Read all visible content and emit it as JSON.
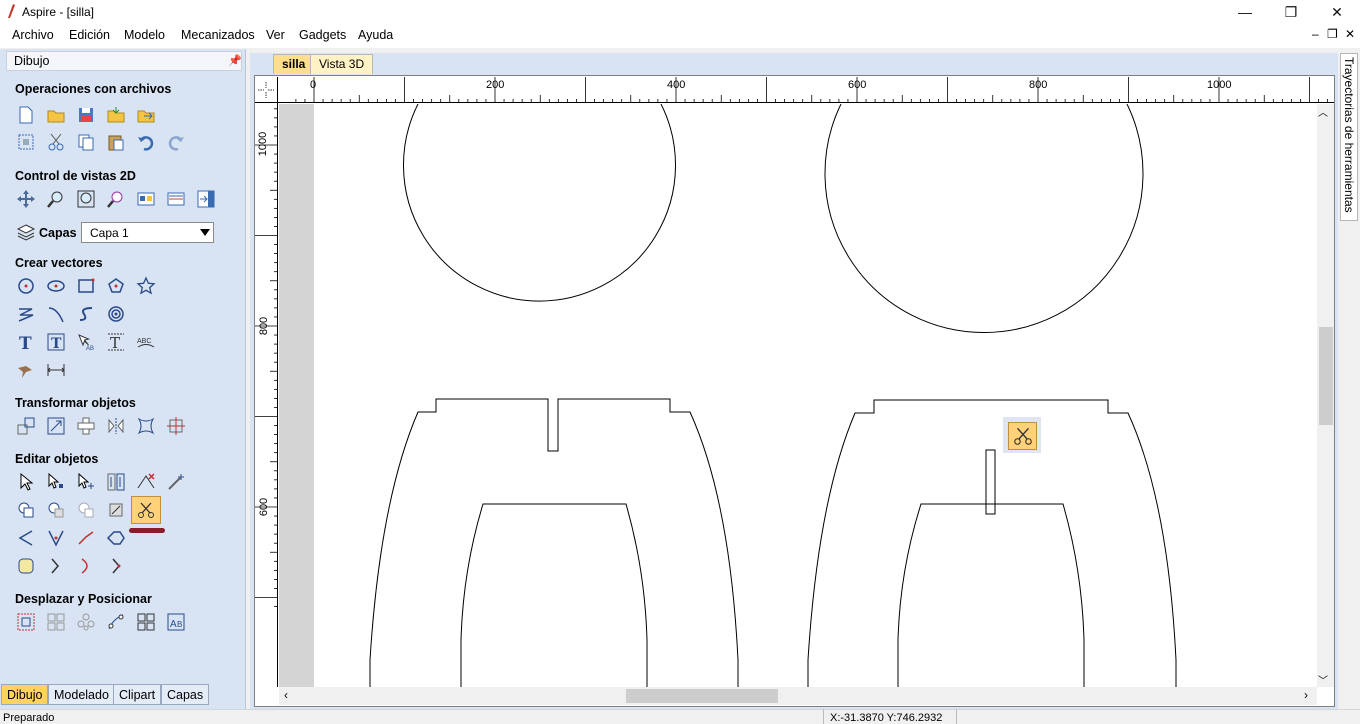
{
  "window": {
    "title": "Aspire - [silla]",
    "controls": [
      "—",
      "❐",
      "✕"
    ]
  },
  "menubar": {
    "items": [
      "Archivo",
      "Edición",
      "Modelo",
      "Mecanizados",
      "Ver",
      "Gadgets",
      "Ayuda"
    ],
    "mdi_controls": [
      "–",
      "❐",
      "✕"
    ]
  },
  "panel": {
    "title": "Dibujo",
    "sections": {
      "files": "Operaciones con archivos",
      "views": "Control de vistas 2D",
      "layers_label": "Capas",
      "create": "Crear vectores",
      "transform": "Transformar objetos",
      "edit": "Editar objetos",
      "position": "Desplazar y Posicionar"
    },
    "layer_value": "Capa 1",
    "bottom_tabs": [
      "Dibujo",
      "Modelado",
      "Clipart",
      "Capas"
    ]
  },
  "document": {
    "tabs": [
      "silla",
      "Vista 3D"
    ],
    "active_tab": "silla",
    "ruler_h": [
      "0",
      "200",
      "400",
      "600",
      "800",
      "1000"
    ],
    "ruler_v": [
      "1000",
      "800",
      "600"
    ]
  },
  "right_panel": {
    "label": "Trayectorias de herramientas"
  },
  "status": {
    "text": "Preparado",
    "coords": "X:-31.3870 Y:746.2932"
  },
  "colors": {
    "panel_bg": "#d8e4f4",
    "active_tab": "#ffd35e",
    "selected_tool": "#ffd27a",
    "underline_mark": "#8b1a2b"
  }
}
